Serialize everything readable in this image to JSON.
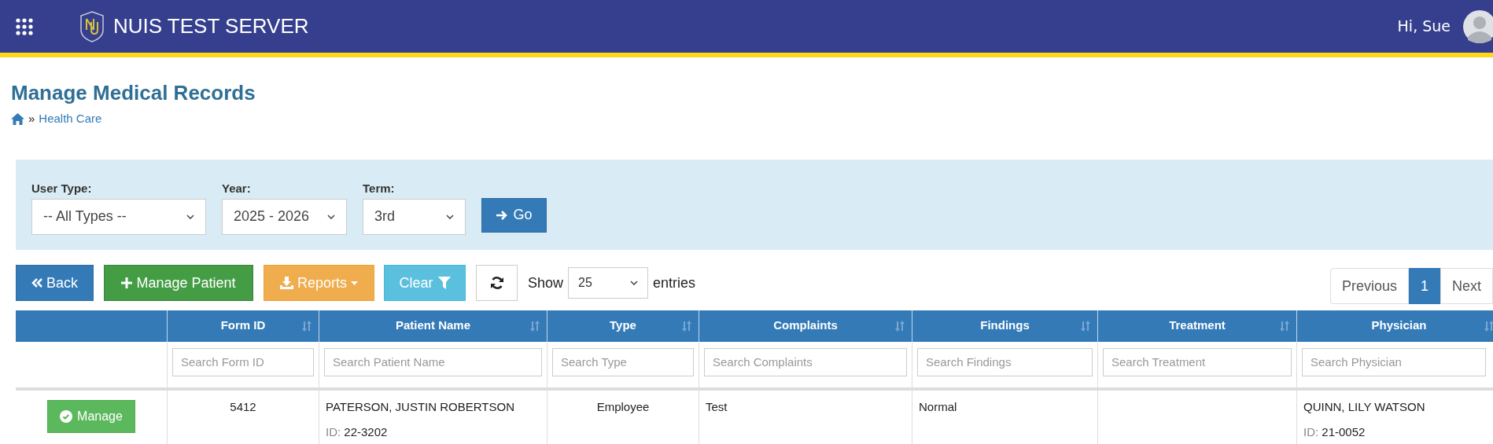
{
  "header": {
    "title": "NUIS TEST SERVER",
    "greeting": "Hi, Sue"
  },
  "page": {
    "title": "Manage Medical Records",
    "breadcrumb": [
      {
        "label": "»",
        "kind": "separator"
      },
      {
        "label": "Health Care",
        "kind": "link"
      }
    ]
  },
  "filters": [
    {
      "label": "User Type:",
      "value": "-- All Types --"
    },
    {
      "label": "Year:",
      "value": "2025 - 2026"
    },
    {
      "label": "Term:",
      "value": "3rd"
    }
  ],
  "go_button": "Go",
  "toolbar": {
    "back": "Back",
    "manage_patient": "Manage Patient",
    "reports": "Reports",
    "clear": "Clear",
    "show_label": "Show",
    "page_size": "25",
    "entries_label": "entries"
  },
  "pagination": [
    {
      "label": "Previous",
      "selected": false
    },
    {
      "label": "1",
      "selected": true
    },
    {
      "label": "Next",
      "selected": false
    }
  ],
  "table": {
    "columns": [
      {},
      {
        "label": "Form ID",
        "placeholder": "Search Form ID"
      },
      {
        "label": "Patient Name",
        "placeholder": "Search Patient Name"
      },
      {
        "label": "Type",
        "placeholder": "Search Type"
      },
      {
        "label": "Complaints",
        "placeholder": "Search Complaints"
      },
      {
        "label": "Findings",
        "placeholder": "Search Findings"
      },
      {
        "label": "Treatment",
        "placeholder": "Search Treatment"
      },
      {
        "label": "Physician",
        "placeholder": "Search Physician"
      }
    ],
    "rows": [
      {
        "action": "Manage",
        "form_id": "5412",
        "patient": {
          "name": "PATERSON, JUSTIN ROBERTSON",
          "id_label": "ID:",
          "id": "22-3202"
        },
        "type": "Employee",
        "complaints": "Test",
        "findings": "Normal",
        "physician": {
          "name": "QUINN, LILY WATSON",
          "id_label": "ID:",
          "id": "21-0052"
        }
      }
    ]
  }
}
